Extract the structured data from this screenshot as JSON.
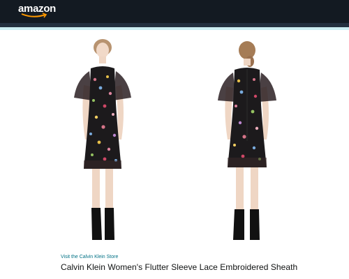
{
  "header": {
    "logo_text": "amazon",
    "colors": {
      "nav": "#131a22",
      "subnav": "#232f3e",
      "accent": "#cdeef2",
      "smile": "#ff9900"
    }
  },
  "product": {
    "store_link": "Visit the Calvin Klein Store",
    "title": "Calvin Klein Women's Flutter Sleeve Lace Embroidered Sheath",
    "images": [
      {
        "view": "front",
        "icon": "dress-front-image"
      },
      {
        "view": "back",
        "icon": "dress-back-image"
      }
    ],
    "colors": {
      "dress": "#1c1a1c",
      "lace": "#3a2a2a",
      "skin": "#f0d8c8",
      "link": "#007185"
    }
  }
}
